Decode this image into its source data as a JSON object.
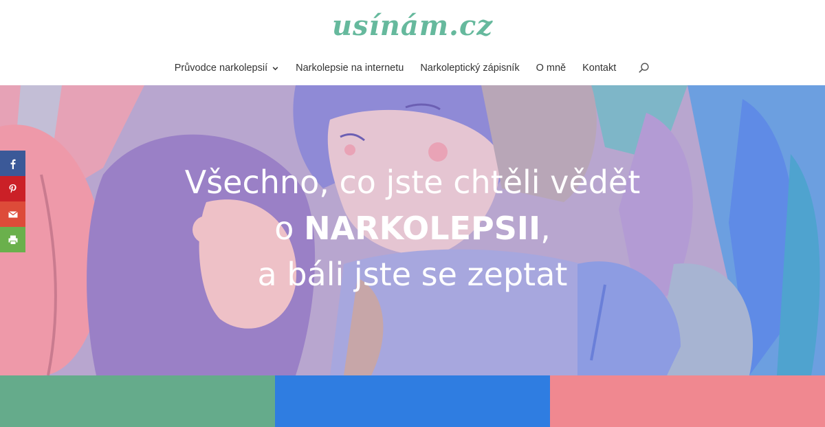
{
  "logo": {
    "text": "usínám.cz",
    "color": "#66b99d"
  },
  "nav": {
    "items": [
      {
        "label": "Průvodce narkolepsií",
        "has_dropdown": true
      },
      {
        "label": "Narkolepsie na internetu"
      },
      {
        "label": "Narkoleptický zápisník"
      },
      {
        "label": "O mně"
      },
      {
        "label": "Kontakt"
      }
    ],
    "search_icon": "search-icon"
  },
  "hero": {
    "line1": "Všechno, co jste chtěli vědět",
    "line2_prefix": "o ",
    "line2_bold": "NARKOLEPSII",
    "line2_suffix": ",",
    "line3": "a báli jste se zeptat"
  },
  "social": [
    {
      "name": "facebook",
      "icon": "facebook-icon",
      "glyph": "f",
      "color": "#3b5998"
    },
    {
      "name": "pinterest",
      "icon": "pinterest-icon",
      "glyph": "P",
      "color": "#cb2027"
    },
    {
      "name": "email",
      "icon": "email-icon",
      "glyph": "✉",
      "color": "#dd4b39"
    },
    {
      "name": "print",
      "icon": "print-icon",
      "glyph": "⎙",
      "color": "#6ab04c"
    }
  ],
  "blocks": [
    {
      "name": "green",
      "color": "#65ab8b"
    },
    {
      "name": "blue",
      "color": "#2f7de1"
    },
    {
      "name": "pink",
      "color": "#f08890"
    }
  ]
}
